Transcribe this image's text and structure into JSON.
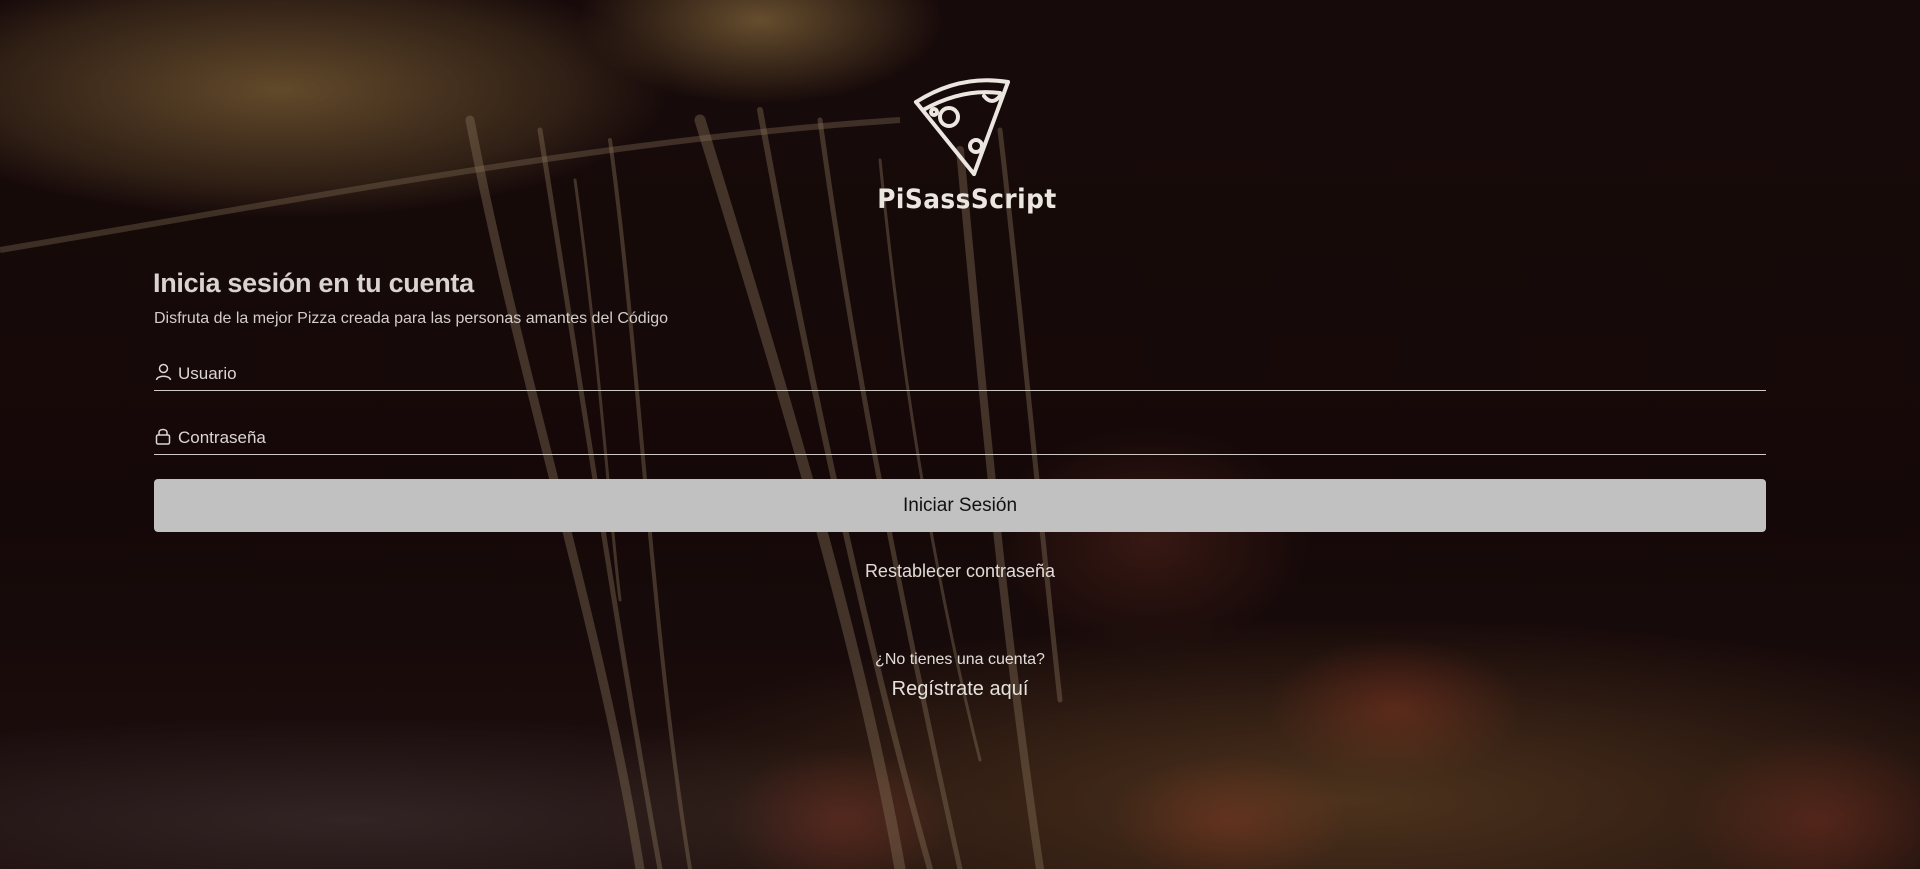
{
  "brand": {
    "name": "PiSassScript",
    "logo_icon": "pizza-slice-icon"
  },
  "login": {
    "title": "Inicia sesión en tu cuenta",
    "subtitle": "Disfruta de la mejor Pizza creada para las personas amantes del Código",
    "username_placeholder": "Usuario",
    "username_icon": "user-icon",
    "password_placeholder": "Contraseña",
    "password_icon": "lock-icon",
    "submit_label": "Iniciar Sesión",
    "reset_label": "Restablecer contraseña",
    "no_account_text": "¿No tienes una cuenta?",
    "register_label": "Regístrate aquí"
  },
  "colors": {
    "background": "#150a0a",
    "text": "#e1dcd7",
    "button": "#c1c1c1",
    "button_text": "#111111"
  }
}
